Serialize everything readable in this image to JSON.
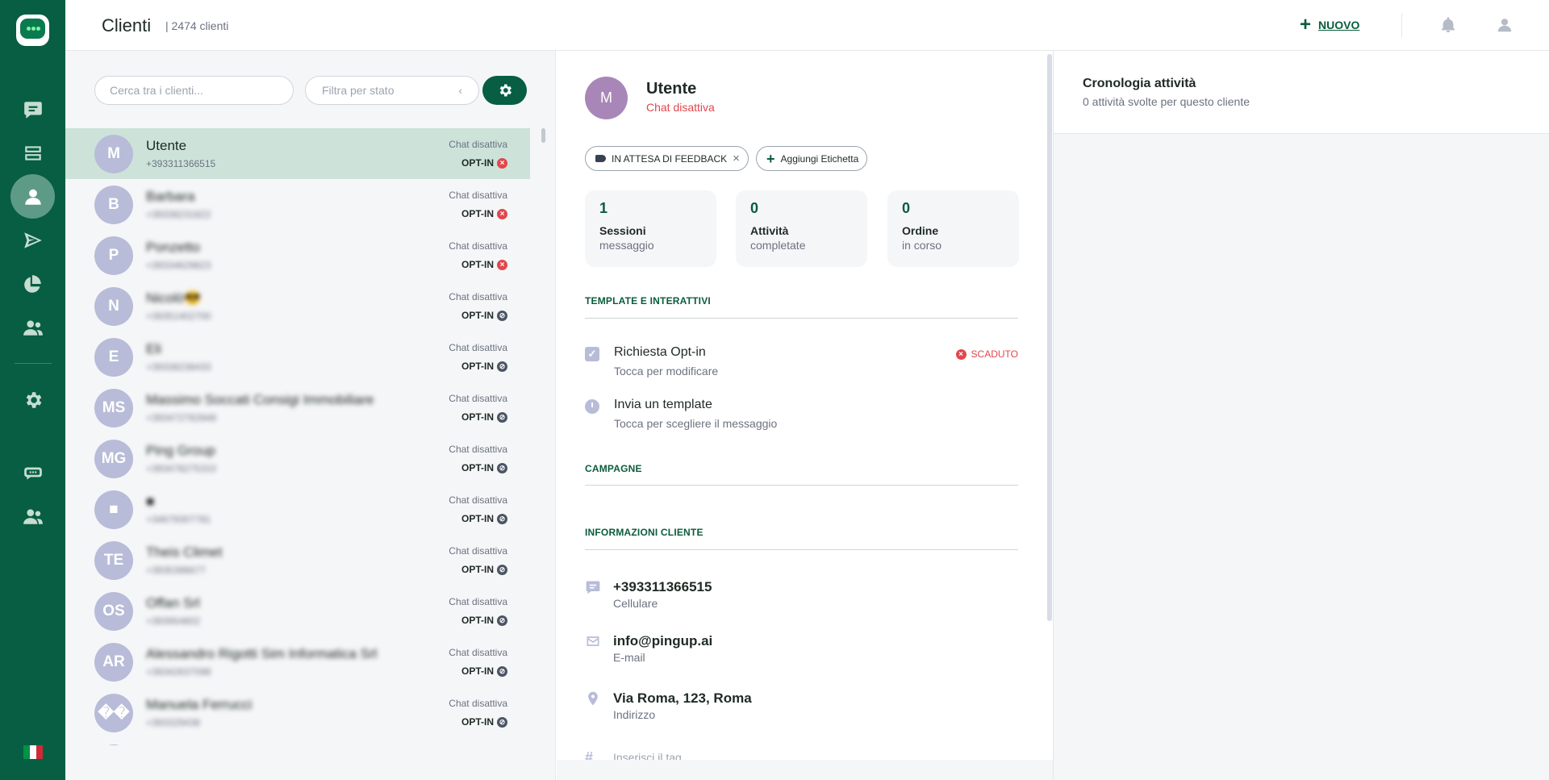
{
  "app": {
    "page_title": "Clienti",
    "client_count": "| 2474 clienti",
    "new_button": "NUOVO",
    "brand_color": "#075e42"
  },
  "sidebar": {
    "items": [
      {
        "name": "chat-icon",
        "active": false
      },
      {
        "name": "inbox-icon",
        "active": false
      },
      {
        "name": "contacts-icon",
        "active": true
      },
      {
        "name": "send-icon",
        "active": false
      },
      {
        "name": "analytics-icon",
        "active": false
      },
      {
        "name": "team-icon",
        "active": false
      },
      {
        "name": "settings-icon",
        "active": false
      },
      {
        "name": "bot-icon",
        "active": false
      },
      {
        "name": "users-icon",
        "active": false
      }
    ],
    "language": "it"
  },
  "list": {
    "search_placeholder": "Cerca tra i clienti...",
    "filter_placeholder": "Filtra per stato",
    "rows": [
      {
        "initials": "M",
        "name": "Utente",
        "phone": "+393311366515",
        "status": "Chat disattiva",
        "optin": "OPT-IN",
        "optin_state": "red",
        "selected": true
      },
      {
        "initials": "B",
        "name": "Barbara",
        "phone": "+39338231822",
        "status": "Chat disattiva",
        "optin": "OPT-IN",
        "optin_state": "red",
        "selected": false
      },
      {
        "initials": "P",
        "name": "Ponzetto",
        "phone": "+39334629823",
        "status": "Chat disattiva",
        "optin": "OPT-IN",
        "optin_state": "red",
        "selected": false
      },
      {
        "initials": "N",
        "name": "Nicolò😎",
        "phone": "+39351402700",
        "status": "Chat disattiva",
        "optin": "OPT-IN",
        "optin_state": "grey",
        "selected": false
      },
      {
        "initials": "E",
        "name": "Eli",
        "phone": "+39338238433",
        "status": "Chat disattiva",
        "optin": "OPT-IN",
        "optin_state": "grey",
        "selected": false
      },
      {
        "initials": "MS",
        "name": "Massimo Soccati Consigi Immobiliare",
        "phone": "+393472762848",
        "status": "Chat disattiva",
        "optin": "OPT-IN",
        "optin_state": "grey",
        "selected": false
      },
      {
        "initials": "MG",
        "name": "Ping Group",
        "phone": "+393478275310",
        "status": "Chat disattiva",
        "optin": "OPT-IN",
        "optin_state": "grey",
        "selected": false
      },
      {
        "initials": "■",
        "name": "■",
        "phone": "+34679307781",
        "status": "Chat disattiva",
        "optin": "OPT-IN",
        "optin_state": "grey",
        "selected": false
      },
      {
        "initials": "TE",
        "name": "Theis Climet",
        "phone": "+3935398677",
        "status": "Chat disattiva",
        "optin": "OPT-IN",
        "optin_state": "grey",
        "selected": false
      },
      {
        "initials": "OS",
        "name": "Offan Srl",
        "phone": "+393954802",
        "status": "Chat disattiva",
        "optin": "OPT-IN",
        "optin_state": "grey",
        "selected": false
      },
      {
        "initials": "AR",
        "name": "Alessandro Rigotti Sim Informatica Srl",
        "phone": "+39342637098",
        "status": "Chat disattiva",
        "optin": "OPT-IN",
        "optin_state": "grey",
        "selected": false
      },
      {
        "initials": "��",
        "name": "Manuela Ferrucci",
        "phone": "+393329438",
        "status": "Chat disattiva",
        "optin": "OPT-IN",
        "optin_state": "grey",
        "selected": false
      }
    ]
  },
  "detail": {
    "initials": "M",
    "name": "Utente",
    "chat_status": "Chat disattiva",
    "tag_label": "IN ATTESA DI FEEDBACK",
    "add_tag_label": "Aggiungi Etichetta",
    "stats": [
      {
        "value": "1",
        "label": "Sessioni",
        "sub": "messaggio"
      },
      {
        "value": "0",
        "label": "Attività",
        "sub": "completate"
      },
      {
        "value": "0",
        "label": "Ordine",
        "sub": "in corso"
      }
    ],
    "section_templates": "TEMPLATE E INTERATTIVI",
    "optin_title": "Richiesta Opt-in",
    "optin_sub": "Tocca per modificare",
    "optin_badge": "SCADUTO",
    "template_title": "Invia un template",
    "template_sub": "Tocca per scegliere il messaggio",
    "section_campaigns": "CAMPAGNE",
    "section_info": "INFORMAZIONI CLIENTE",
    "phone_value": "+393311366515",
    "phone_label": "Cellulare",
    "email_value": "info@pingup.ai",
    "email_label": "E-mail",
    "address_value": "Via Roma, 123, Roma",
    "address_label": "Indirizzo",
    "tag_placeholder": "Inserisci il tag"
  },
  "activity": {
    "title": "Cronologia attività",
    "subtitle": "0 attività svolte per questo cliente"
  }
}
